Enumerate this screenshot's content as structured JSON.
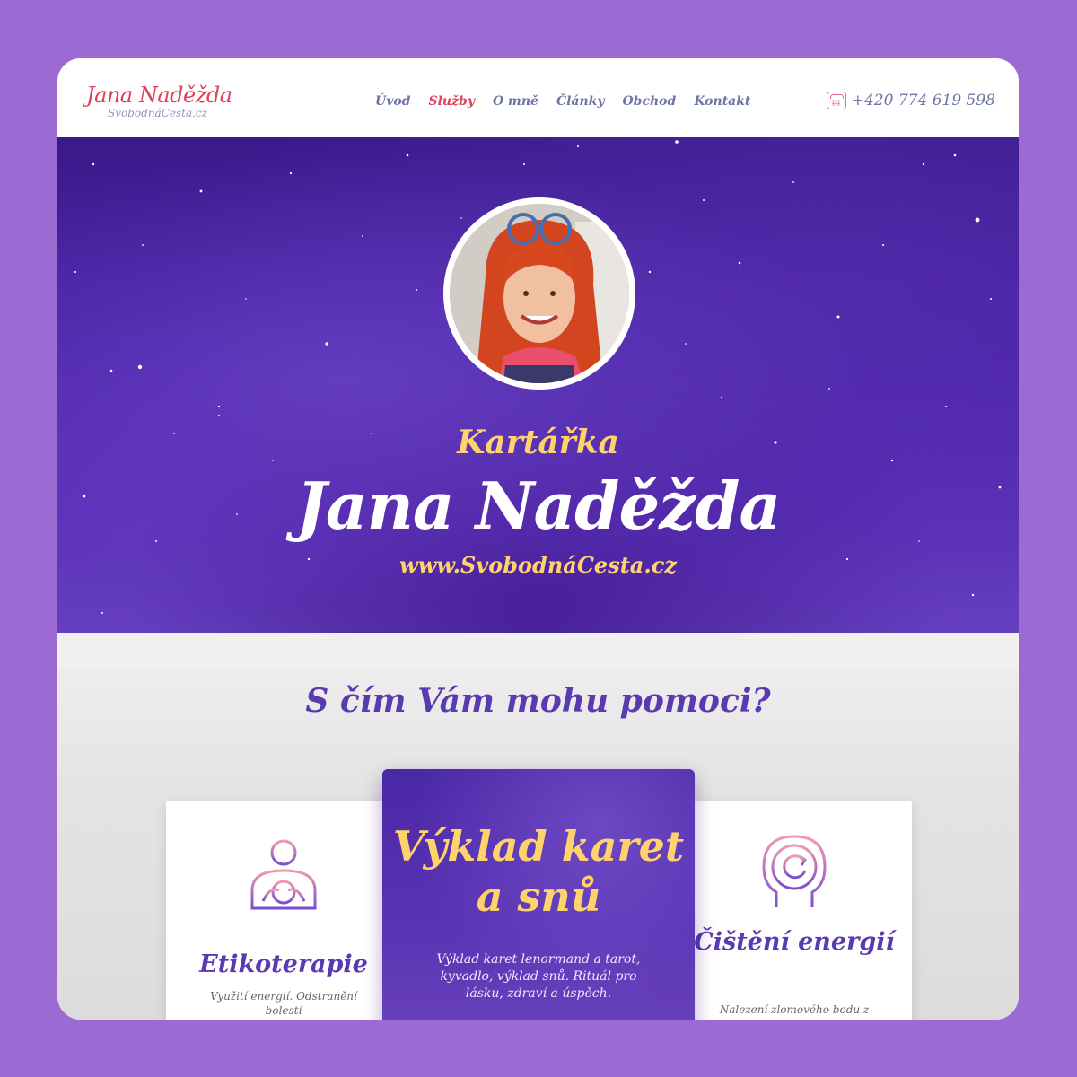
{
  "header": {
    "logo_name": "Jana Naděžda",
    "logo_sub": "SvobodnáCesta.cz",
    "nav": [
      {
        "label": "Úvod",
        "active": false
      },
      {
        "label": "Služby",
        "active": true
      },
      {
        "label": "O mně",
        "active": false
      },
      {
        "label": "Články",
        "active": false
      },
      {
        "label": "Obchod",
        "active": false
      },
      {
        "label": "Kontakt",
        "active": false
      }
    ],
    "phone_icon": "phone-icon",
    "phone": "+420 774 619 598"
  },
  "hero": {
    "subtitle": "Kartářka",
    "title": "Jana Naděžda",
    "url": "www.SvobodnáCesta.cz"
  },
  "services": {
    "heading": "S čím Vám mohu pomoci?",
    "cards": [
      {
        "icon": "person-holding-ball-icon",
        "title": "Etikoterapie",
        "text": "Využití energií. Odstranění bolestí"
      },
      {
        "icon": null,
        "title": "Výklad karet a snů",
        "text": "Výklad karet lenormand a tarot, kyvadlo, výklad snů. Rituál pro lásku, zdraví a úspěch."
      },
      {
        "icon": "head-refresh-icon",
        "title": "Čištění energií",
        "text": "Nalezení zlomového bodu z"
      }
    ]
  },
  "colors": {
    "background": "#9b6bd3",
    "brand_red": "#e0405a",
    "nav_text": "#6e74a4",
    "gold": "#ffd36b",
    "purple": "#5a3ab0"
  }
}
